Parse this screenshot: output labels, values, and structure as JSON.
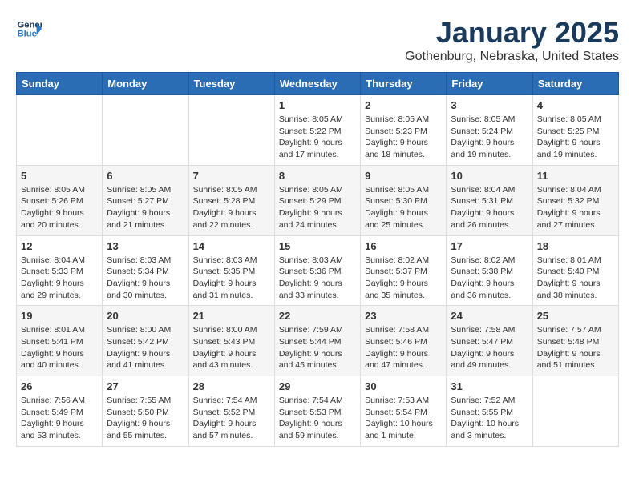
{
  "logo": {
    "line1": "General",
    "line2": "Blue"
  },
  "title": "January 2025",
  "subtitle": "Gothenburg, Nebraska, United States",
  "days_of_week": [
    "Sunday",
    "Monday",
    "Tuesday",
    "Wednesday",
    "Thursday",
    "Friday",
    "Saturday"
  ],
  "weeks": [
    [
      {
        "day": "",
        "info": ""
      },
      {
        "day": "",
        "info": ""
      },
      {
        "day": "",
        "info": ""
      },
      {
        "day": "1",
        "info": "Sunrise: 8:05 AM\nSunset: 5:22 PM\nDaylight: 9 hours\nand 17 minutes."
      },
      {
        "day": "2",
        "info": "Sunrise: 8:05 AM\nSunset: 5:23 PM\nDaylight: 9 hours\nand 18 minutes."
      },
      {
        "day": "3",
        "info": "Sunrise: 8:05 AM\nSunset: 5:24 PM\nDaylight: 9 hours\nand 19 minutes."
      },
      {
        "day": "4",
        "info": "Sunrise: 8:05 AM\nSunset: 5:25 PM\nDaylight: 9 hours\nand 19 minutes."
      }
    ],
    [
      {
        "day": "5",
        "info": "Sunrise: 8:05 AM\nSunset: 5:26 PM\nDaylight: 9 hours\nand 20 minutes."
      },
      {
        "day": "6",
        "info": "Sunrise: 8:05 AM\nSunset: 5:27 PM\nDaylight: 9 hours\nand 21 minutes."
      },
      {
        "day": "7",
        "info": "Sunrise: 8:05 AM\nSunset: 5:28 PM\nDaylight: 9 hours\nand 22 minutes."
      },
      {
        "day": "8",
        "info": "Sunrise: 8:05 AM\nSunset: 5:29 PM\nDaylight: 9 hours\nand 24 minutes."
      },
      {
        "day": "9",
        "info": "Sunrise: 8:05 AM\nSunset: 5:30 PM\nDaylight: 9 hours\nand 25 minutes."
      },
      {
        "day": "10",
        "info": "Sunrise: 8:04 AM\nSunset: 5:31 PM\nDaylight: 9 hours\nand 26 minutes."
      },
      {
        "day": "11",
        "info": "Sunrise: 8:04 AM\nSunset: 5:32 PM\nDaylight: 9 hours\nand 27 minutes."
      }
    ],
    [
      {
        "day": "12",
        "info": "Sunrise: 8:04 AM\nSunset: 5:33 PM\nDaylight: 9 hours\nand 29 minutes."
      },
      {
        "day": "13",
        "info": "Sunrise: 8:03 AM\nSunset: 5:34 PM\nDaylight: 9 hours\nand 30 minutes."
      },
      {
        "day": "14",
        "info": "Sunrise: 8:03 AM\nSunset: 5:35 PM\nDaylight: 9 hours\nand 31 minutes."
      },
      {
        "day": "15",
        "info": "Sunrise: 8:03 AM\nSunset: 5:36 PM\nDaylight: 9 hours\nand 33 minutes."
      },
      {
        "day": "16",
        "info": "Sunrise: 8:02 AM\nSunset: 5:37 PM\nDaylight: 9 hours\nand 35 minutes."
      },
      {
        "day": "17",
        "info": "Sunrise: 8:02 AM\nSunset: 5:38 PM\nDaylight: 9 hours\nand 36 minutes."
      },
      {
        "day": "18",
        "info": "Sunrise: 8:01 AM\nSunset: 5:40 PM\nDaylight: 9 hours\nand 38 minutes."
      }
    ],
    [
      {
        "day": "19",
        "info": "Sunrise: 8:01 AM\nSunset: 5:41 PM\nDaylight: 9 hours\nand 40 minutes."
      },
      {
        "day": "20",
        "info": "Sunrise: 8:00 AM\nSunset: 5:42 PM\nDaylight: 9 hours\nand 41 minutes."
      },
      {
        "day": "21",
        "info": "Sunrise: 8:00 AM\nSunset: 5:43 PM\nDaylight: 9 hours\nand 43 minutes."
      },
      {
        "day": "22",
        "info": "Sunrise: 7:59 AM\nSunset: 5:44 PM\nDaylight: 9 hours\nand 45 minutes."
      },
      {
        "day": "23",
        "info": "Sunrise: 7:58 AM\nSunset: 5:46 PM\nDaylight: 9 hours\nand 47 minutes."
      },
      {
        "day": "24",
        "info": "Sunrise: 7:58 AM\nSunset: 5:47 PM\nDaylight: 9 hours\nand 49 minutes."
      },
      {
        "day": "25",
        "info": "Sunrise: 7:57 AM\nSunset: 5:48 PM\nDaylight: 9 hours\nand 51 minutes."
      }
    ],
    [
      {
        "day": "26",
        "info": "Sunrise: 7:56 AM\nSunset: 5:49 PM\nDaylight: 9 hours\nand 53 minutes."
      },
      {
        "day": "27",
        "info": "Sunrise: 7:55 AM\nSunset: 5:50 PM\nDaylight: 9 hours\nand 55 minutes."
      },
      {
        "day": "28",
        "info": "Sunrise: 7:54 AM\nSunset: 5:52 PM\nDaylight: 9 hours\nand 57 minutes."
      },
      {
        "day": "29",
        "info": "Sunrise: 7:54 AM\nSunset: 5:53 PM\nDaylight: 9 hours\nand 59 minutes."
      },
      {
        "day": "30",
        "info": "Sunrise: 7:53 AM\nSunset: 5:54 PM\nDaylight: 10 hours\nand 1 minute."
      },
      {
        "day": "31",
        "info": "Sunrise: 7:52 AM\nSunset: 5:55 PM\nDaylight: 10 hours\nand 3 minutes."
      },
      {
        "day": "",
        "info": ""
      }
    ]
  ]
}
